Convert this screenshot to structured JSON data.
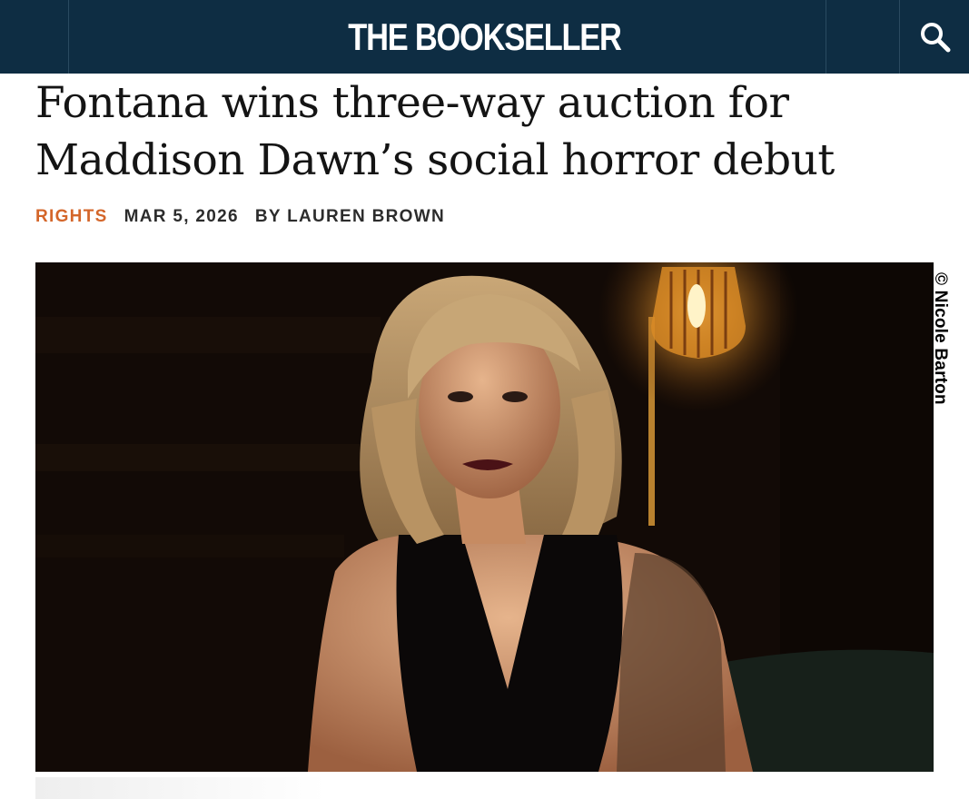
{
  "header": {
    "logo": "THE BOOKSELLER",
    "search_icon": "search-icon"
  },
  "article": {
    "headline": "Fontana wins three-way auction for Maddison Dawn’s social horror debut",
    "category": "RIGHTS",
    "date": "MAR 5, 2026",
    "byline": "BY LAUREN BROWN"
  },
  "photo": {
    "credit": "© Nicole Barton"
  },
  "colors": {
    "header_bg": "#0e2d43",
    "category": "#d4662a",
    "headline": "#141414"
  }
}
